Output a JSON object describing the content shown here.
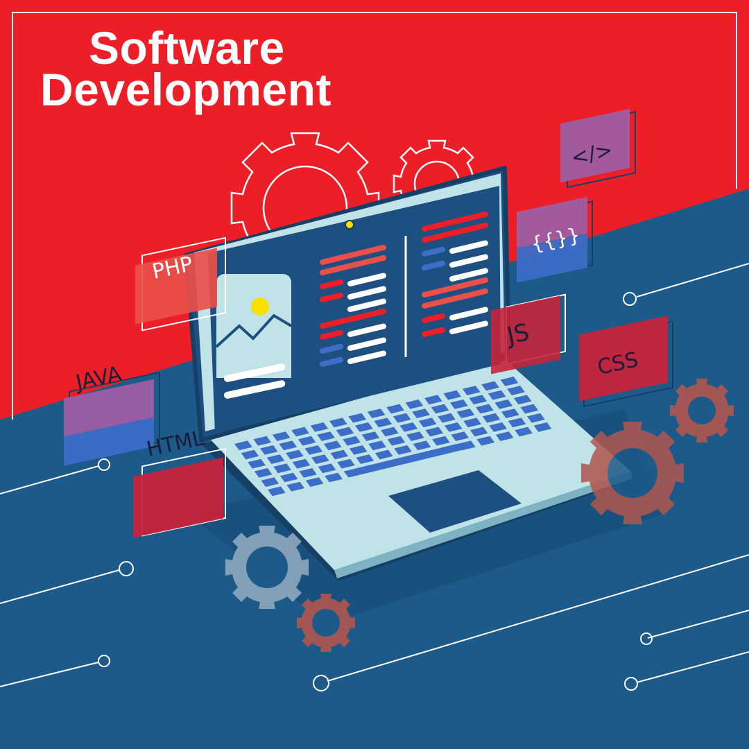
{
  "title": {
    "line1": "Software",
    "line2": "Development"
  },
  "tags": {
    "php": "PHP",
    "java": "JAVA",
    "html": "HTML",
    "js": "JS",
    "css": "CSS",
    "code": "</>",
    "braces": "{{}}"
  },
  "colors": {
    "red": "#ec1e28",
    "navy": "#1c5a8a",
    "screen": "#1d4f80",
    "laptop_body": "#bfe3e6",
    "key": "#3c6ec8",
    "gear": "#b2564f"
  }
}
